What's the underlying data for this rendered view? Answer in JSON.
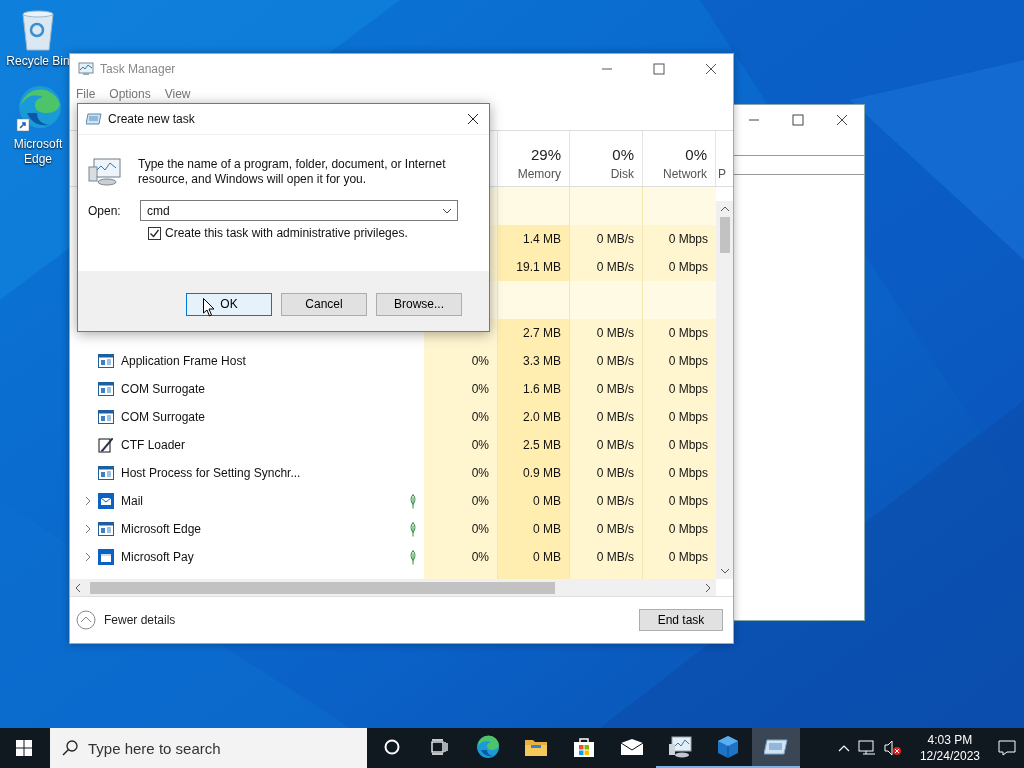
{
  "desktop_icons": [
    {
      "kind": "recycle_bin",
      "label": "Recycle Bin"
    },
    {
      "kind": "edge",
      "label": "Microsoft Edge"
    }
  ],
  "task_manager": {
    "title": "Task Manager",
    "menu": [
      "File",
      "Options",
      "View"
    ],
    "columns": [
      {
        "percent": "29%",
        "label": "Memory"
      },
      {
        "percent": "0%",
        "label": "Disk"
      },
      {
        "percent": "0%",
        "label": "Network"
      },
      {
        "label": "P"
      }
    ],
    "rows": [
      {
        "kind": "group"
      },
      {
        "kind": "blank",
        "memory": "1.4 MB",
        "disk": "0 MB/s",
        "network": "0 Mbps"
      },
      {
        "kind": "blank",
        "memory": "19.1 MB",
        "disk": "0 MB/s",
        "network": "0 Mbps"
      },
      {
        "kind": "group"
      },
      {
        "kind": "blank",
        "memory": "2.7 MB",
        "disk": "0 MB/s",
        "network": "0 Mbps"
      },
      {
        "kind": "window",
        "name": "Application Frame Host",
        "expandable": false,
        "suspended": false,
        "cpu": "0%",
        "memory": "3.3 MB",
        "disk": "0 MB/s",
        "network": "0 Mbps"
      },
      {
        "kind": "window",
        "name": "COM Surrogate",
        "expandable": false,
        "suspended": false,
        "cpu": "0%",
        "memory": "1.6 MB",
        "disk": "0 MB/s",
        "network": "0 Mbps"
      },
      {
        "kind": "window",
        "name": "COM Surrogate",
        "expandable": false,
        "suspended": false,
        "cpu": "0%",
        "memory": "2.0 MB",
        "disk": "0 MB/s",
        "network": "0 Mbps"
      },
      {
        "kind": "pen",
        "name": "CTF Loader",
        "expandable": false,
        "suspended": false,
        "cpu": "0%",
        "memory": "2.5 MB",
        "disk": "0 MB/s",
        "network": "0 Mbps"
      },
      {
        "kind": "window",
        "name": "Host Process for Setting Synchr...",
        "expandable": false,
        "suspended": false,
        "cpu": "0%",
        "memory": "0.9 MB",
        "disk": "0 MB/s",
        "network": "0 Mbps"
      },
      {
        "kind": "mail",
        "name": "Mail",
        "expandable": true,
        "suspended": true,
        "cpu": "0%",
        "memory": "0 MB",
        "disk": "0 MB/s",
        "network": "0 Mbps"
      },
      {
        "kind": "window",
        "name": "Microsoft Edge",
        "expandable": true,
        "suspended": true,
        "cpu": "0%",
        "memory": "0 MB",
        "disk": "0 MB/s",
        "network": "0 Mbps"
      },
      {
        "kind": "card",
        "name": "Microsoft Pay",
        "expandable": true,
        "suspended": true,
        "cpu": "0%",
        "memory": "0 MB",
        "disk": "0 MB/s",
        "network": "0 Mbps"
      }
    ],
    "fewer_details": "Fewer details",
    "end_task": "End task"
  },
  "run_dialog": {
    "title": "Create new task",
    "description": "Type the name of a program, folder, document, or Internet resource, and Windows will open it for you.",
    "open_label": "Open:",
    "open_value": "cmd",
    "admin": {
      "label": "Create this task with administrative privileges.",
      "checked": true
    },
    "buttons": [
      {
        "label": "OK",
        "default": true
      },
      {
        "label": "Cancel",
        "default": false
      },
      {
        "label": "Browse...",
        "default": false
      }
    ]
  },
  "taskbar": {
    "search_placeholder": "Type here to search",
    "apps": [
      {
        "kind": "cortana",
        "running": false,
        "active": false
      },
      {
        "kind": "task_view",
        "running": false,
        "active": false
      },
      {
        "kind": "edge",
        "running": false,
        "active": false
      },
      {
        "kind": "explorer",
        "running": false,
        "active": false
      },
      {
        "kind": "store",
        "running": false,
        "active": false
      },
      {
        "kind": "mail",
        "running": false,
        "active": false
      },
      {
        "kind": "task_manager",
        "running": true,
        "active": false
      },
      {
        "kind": "cube",
        "running": true,
        "active": false
      },
      {
        "kind": "run",
        "running": true,
        "active": true
      }
    ],
    "time": "4:03 PM",
    "date": "12/24/2023"
  }
}
